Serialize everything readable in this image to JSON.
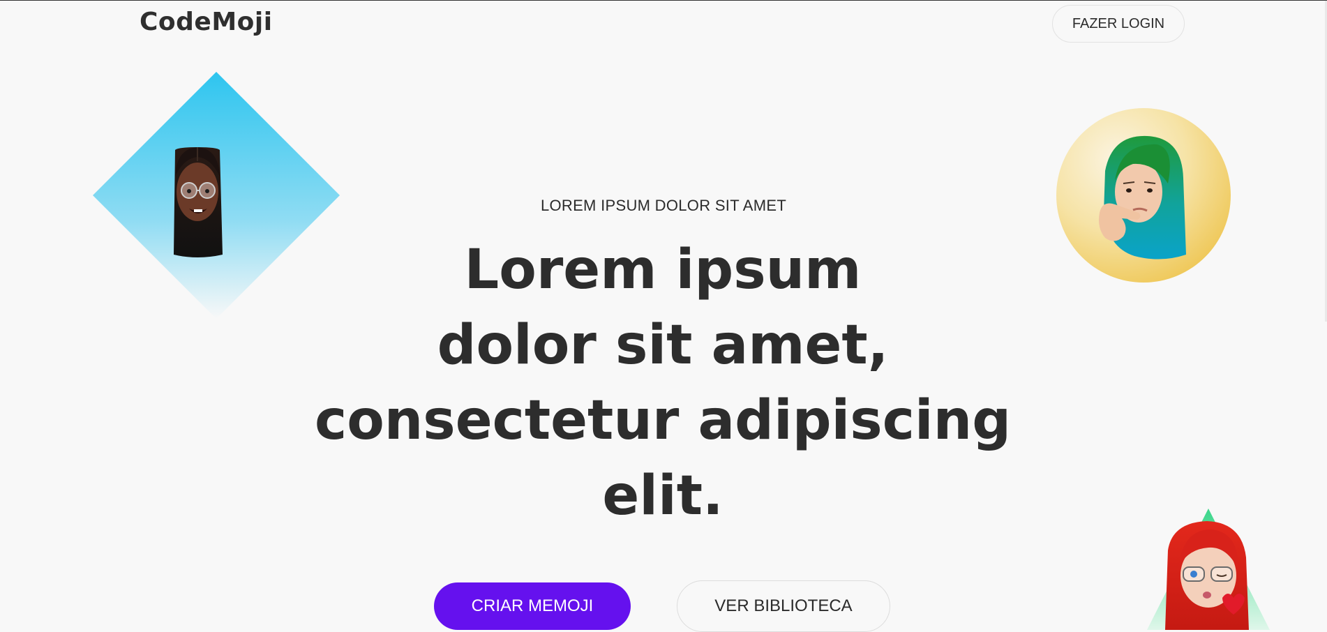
{
  "header": {
    "brand": "CodeMoji",
    "login_label": "FAZER LOGIN"
  },
  "hero": {
    "eyebrow": "LOREM IPSUM DOLOR SIT AMET",
    "headline_lines": [
      "Lorem ipsum",
      "dolor sit amet,",
      "consectetur adipiscing",
      "elit."
    ],
    "primary_cta": "CRIAR MEMOJI",
    "secondary_cta": "VER BIBLIOTECA"
  },
  "colors": {
    "primary": "#6511ee",
    "background": "#f8f8f8",
    "text": "#2d2d2d",
    "diamond_top": "#35c8ef",
    "circle_yellow": "#f0cc55",
    "triangle_green": "#3bd68a"
  },
  "decor": {
    "avatar_diamond": "memoji-avatar-dark-hair",
    "avatar_circle": "memoji-avatar-green-hair",
    "avatar_triangle": "memoji-avatar-red-hair"
  }
}
